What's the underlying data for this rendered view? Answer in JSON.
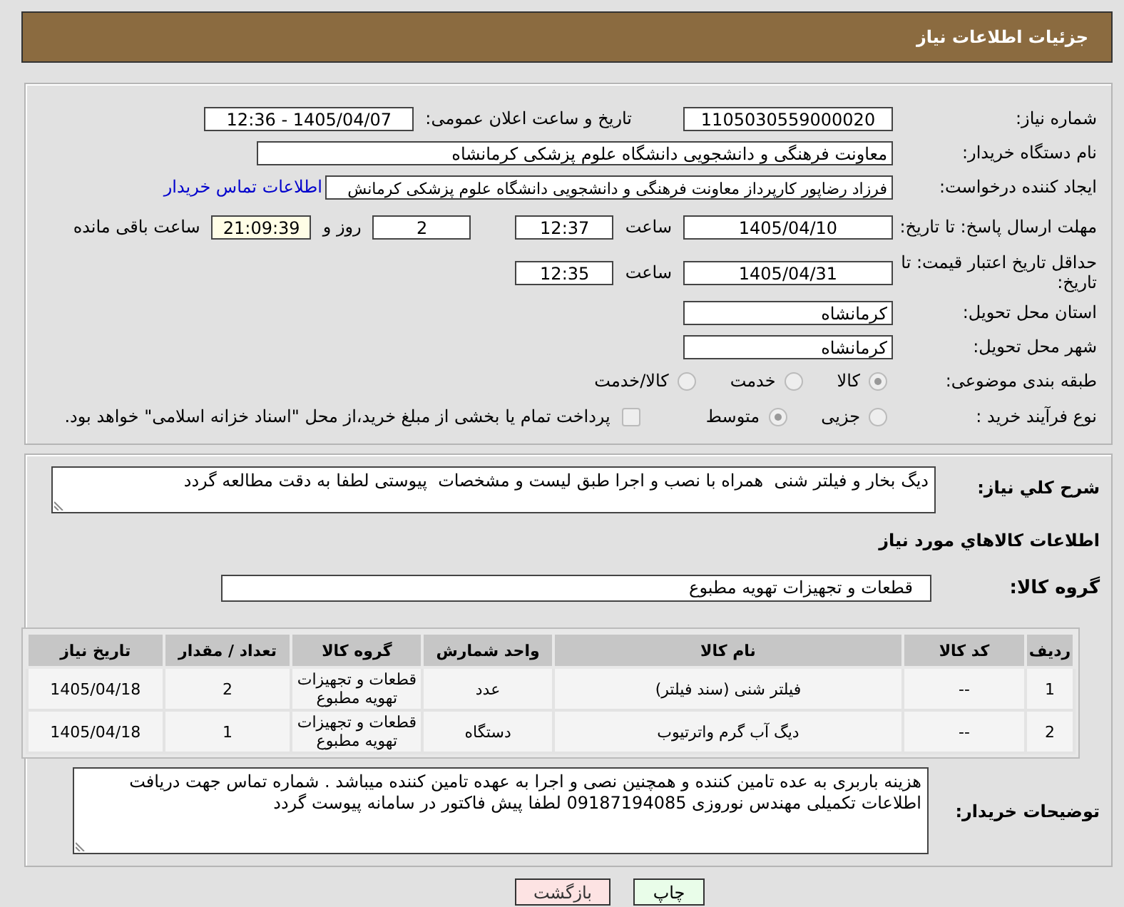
{
  "header": {
    "title": "جزئیات اطلاعات نیاز"
  },
  "need_number": {
    "label": "شماره نیاز:",
    "value": "1105030559000020"
  },
  "announce": {
    "label": "تاریخ و ساعت اعلان عمومی:",
    "value": "1405/04/07 - 12:36"
  },
  "buyer": {
    "label": "نام دستگاه خریدار:",
    "value": "معاونت فرهنگی و دانشجویی دانشگاه علوم پزشکی کرمانشاه"
  },
  "requester": {
    "label": "ایجاد کننده درخواست:",
    "value": "فرزاد رضاپور کارپرداز معاونت فرهنگی و دانشجویی دانشگاه علوم پزشکی کرمانش",
    "link": "اطلاعات تماس خریدار"
  },
  "reply_deadline": {
    "label": "مهلت ارسال پاسخ: تا تاریخ:",
    "date": "1405/04/10",
    "time_label": "ساعت",
    "time": "12:37",
    "days": "2",
    "days_label": "روز و",
    "remaining": "21:09:39",
    "remaining_label": "ساعت باقی مانده"
  },
  "price_validity": {
    "label": "حداقل تاریخ اعتبار قیمت: تا تاریخ:",
    "date": "1405/04/31",
    "time_label": "ساعت",
    "time": "12:35"
  },
  "province": {
    "label": "استان محل تحویل:",
    "value": "کرمانشاه"
  },
  "city": {
    "label": "شهر محل تحویل:",
    "value": "کرمانشاه"
  },
  "category": {
    "label": "طبقه بندی موضوعی:",
    "options": [
      {
        "label": "کالا",
        "selected": true
      },
      {
        "label": "خدمت",
        "selected": false
      },
      {
        "label": "کالا/خدمت",
        "selected": false
      }
    ]
  },
  "purchase_process": {
    "label": "نوع فرآیند خرید :",
    "options": [
      {
        "label": "جزیی",
        "selected": false
      },
      {
        "label": "متوسط",
        "selected": true
      }
    ],
    "payment_note": {
      "label": "پرداخت تمام یا بخشی از مبلغ خرید،از محل \"اسناد خزانه اسلامی\" خواهد بود.",
      "checked": false
    }
  },
  "description": {
    "label": "شرح کلي نياز:",
    "value": "دیگ بخار و فیلتر شنی  همراه با نصب و اجرا طبق لیست و مشخصات  پیوستی لطفا به دقت مطالعه گردد"
  },
  "goods_title": "اطلاعات کالاهاي مورد نياز",
  "goods_group": {
    "label": "گروه کالا:",
    "value": "قطعات و تجهیزات تهویه مطبوع"
  },
  "table": {
    "columns": [
      "ردیف",
      "کد کالا",
      "نام کالا",
      "واحد شمارش",
      "گروه کالا",
      "تعداد / مقدار",
      "تاریخ نیاز"
    ],
    "rows": [
      [
        "1",
        "--",
        "فیلتر شنی (سند فیلتر)",
        "عدد",
        "قطعات و تجهیزات تهویه مطبوع",
        "2",
        "1405/04/18"
      ],
      [
        "2",
        "--",
        "دیگ آب گرم واترتیوب",
        "دستگاه",
        "قطعات و تجهیزات تهویه مطبوع",
        "1",
        "1405/04/18"
      ]
    ]
  },
  "buyer_notes": {
    "label": "توضیحات خریدار:",
    "value": "هزینه باربری به عده تامین کننده و همچنین نصی و اجرا به عهده تامین کننده میباشد . شماره تماس جهت دریافت اطلاعات تکمیلی مهندس نوروزی 09187194085 لطفا پیش فاکتور در سامانه پیوست گردد"
  },
  "buttons": [
    {
      "label": "چاپ",
      "kind": "print"
    },
    {
      "label": "بازگشت",
      "kind": "back"
    }
  ]
}
